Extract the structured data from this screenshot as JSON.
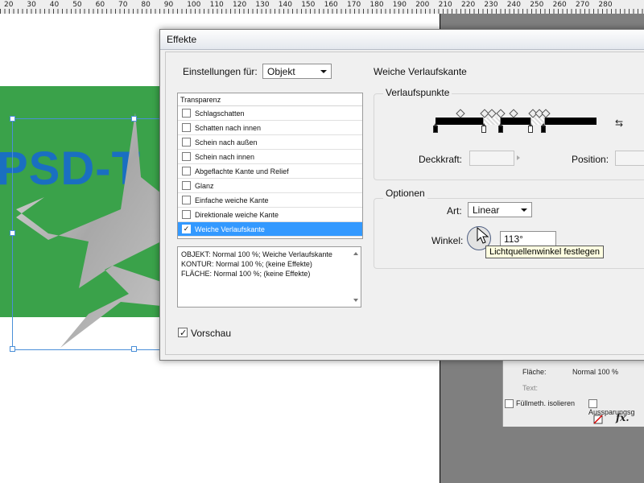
{
  "ruler": {
    "labels": [
      "20",
      "30",
      "40",
      "50",
      "60",
      "70",
      "80",
      "90",
      "100",
      "110",
      "120",
      "130",
      "140",
      "150",
      "160",
      "170",
      "180",
      "190",
      "200",
      "210",
      "220",
      "230",
      "240",
      "250",
      "260",
      "270",
      "280"
    ]
  },
  "colors": {
    "green": "#3aa24a",
    "blue_text": "#1a6fc1",
    "selection_blue": "#4a8fd8",
    "list_selected": "#3399ff",
    "pasteboard": "#7f7f7f"
  },
  "canvas": {
    "text": "PSD-T"
  },
  "layers_panel": {
    "flaeche_label": "Fläche:",
    "flaeche_value": "Normal 100 %",
    "text_label": "Text:",
    "isolate_label": "Füllmeth. isolieren",
    "knockout_label": "Aussparungsg",
    "icons": [
      "delete-effect-icon",
      "fx-icon"
    ]
  },
  "dialog": {
    "title": "Effekte",
    "settings_for_label": "Einstellungen für:",
    "settings_for_value": "Objekt",
    "effects_header": "Transparenz",
    "effects": [
      {
        "label": "Schlagschatten",
        "checked": false
      },
      {
        "label": "Schatten nach innen",
        "checked": false
      },
      {
        "label": "Schein nach außen",
        "checked": false
      },
      {
        "label": "Schein nach innen",
        "checked": false
      },
      {
        "label": "Abgeflachte Kante und Relief",
        "checked": false
      },
      {
        "label": "Glanz",
        "checked": false
      },
      {
        "label": "Einfache weiche Kante",
        "checked": false
      },
      {
        "label": "Direktionale weiche Kante",
        "checked": false
      },
      {
        "label": "Weiche Verlaufskante",
        "checked": true
      }
    ],
    "summary": [
      "OBJEKT: Normal 100 %; Weiche Verlaufskante",
      "KONTUR: Normal 100 %; (keine Effekte)",
      "FLÄCHE: Normal 100 %; (keine Effekte)"
    ],
    "preview_label": "Vorschau",
    "preview_checked": true,
    "section_title": "Weiche Verlaufskante",
    "gradient_points_title": "Verlaufspunkte",
    "opacity_label": "Deckkraft:",
    "position_label": "Position:",
    "options_title": "Optionen",
    "type_label": "Art:",
    "type_value": "Linear",
    "angle_label": "Winkel:",
    "angle_value": "113°",
    "tooltip": "Lichtquellenwinkel festlegen"
  }
}
